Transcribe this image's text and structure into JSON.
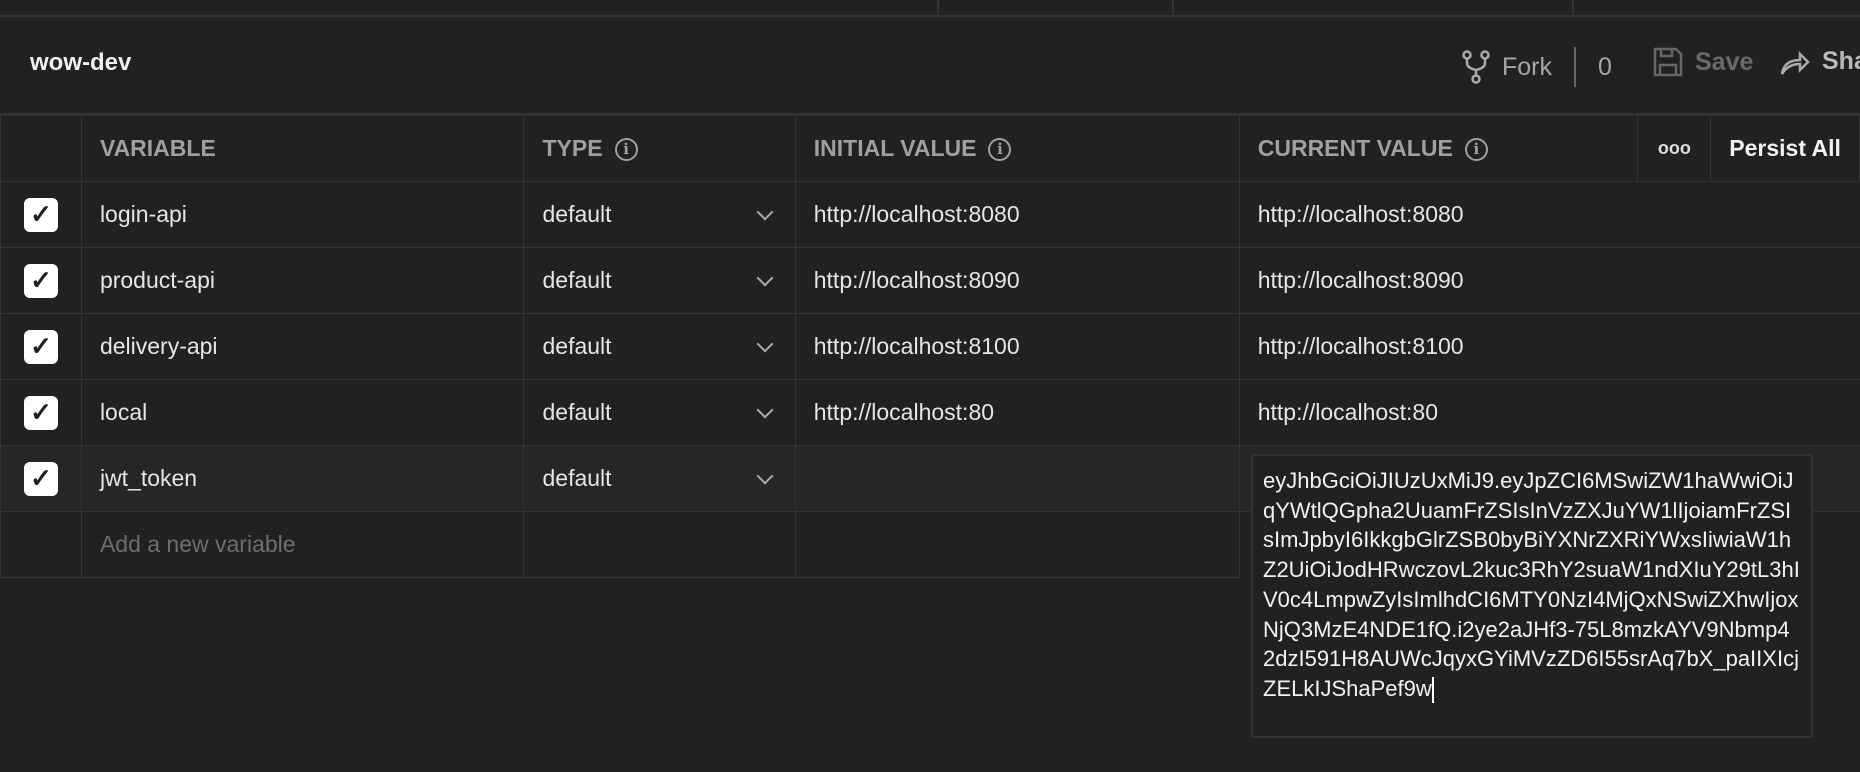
{
  "header": {
    "title": "wow-dev",
    "fork_label": "Fork",
    "fork_count": "0",
    "save_label": "Save",
    "share_label": "Share"
  },
  "table": {
    "columns": {
      "variable": "VARIABLE",
      "type": "TYPE",
      "initial": "INITIAL VALUE",
      "current": "CURRENT VALUE",
      "more": "ooo",
      "persist": "Persist All"
    },
    "rows": [
      {
        "name": "login-api",
        "type": "default",
        "initial": "http://localhost:8080",
        "current": "http://localhost:8080",
        "checked": true
      },
      {
        "name": "product-api",
        "type": "default",
        "initial": "http://localhost:8090",
        "current": "http://localhost:8090",
        "checked": true
      },
      {
        "name": "delivery-api",
        "type": "default",
        "initial": "http://localhost:8100",
        "current": "http://localhost:8100",
        "checked": true
      },
      {
        "name": "local",
        "type": "default",
        "initial": "http://localhost:80",
        "current": "http://localhost:80",
        "checked": true
      },
      {
        "name": "jwt_token",
        "type": "default",
        "initial": "",
        "current": "eyJhbGciOiJIUzUxMiJ9.eyJpZCI6MSwiZW1haWwiOiJqYWtlQGpha2UuamFrZSIsInVzZXJuYW1lIjoiamFrZSIsImJpbyI6IkkgbGlrZSB0byBiYXNrZXRiYWxsIiwiaW1hZ2UiOiJodHRwczovL2kuc3RhY2suaW1ndXIuY29tL3hIV0c4LmpwZyIsImlhdCI6MTY0NzI4MjQxNSwiZXhwIjoxNjQ3MzE4NDE1fQ.i2ye2aJHf3-75L8mzkAYV9Nbmp42dzI591H8AUWcJqyxGYiMVzZD6I55srAq7bX_paIIXIcjZELkIJShaPef9w",
        "checked": true
      }
    ],
    "add_placeholder": "Add a new variable"
  }
}
